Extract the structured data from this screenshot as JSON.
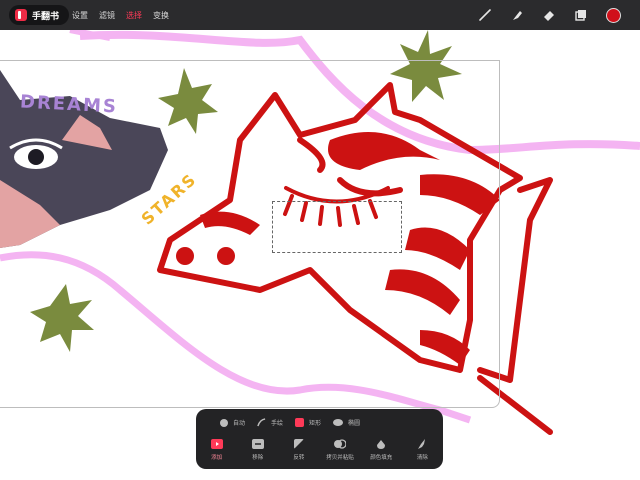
{
  "app": {
    "title": "手翻书"
  },
  "menu": {
    "items": [
      {
        "label": "设置",
        "active": false
      },
      {
        "label": "滤镜",
        "active": false
      },
      {
        "label": "选择",
        "active": true
      },
      {
        "label": "变换",
        "active": false
      }
    ]
  },
  "toolbar": {
    "icons": [
      "brush-icon",
      "smudge-icon",
      "eraser-icon",
      "layers-icon",
      "color-picker-icon"
    ],
    "current_color": "#d0101a"
  },
  "canvas": {
    "texts": {
      "dreams": "DREAMS",
      "stars": "STARS"
    },
    "colors": {
      "red": "#cc1212",
      "pink": "#f4b4f2",
      "green": "#7a8b3e",
      "dark": "#4a4658"
    }
  },
  "selection_panel": {
    "modes": [
      {
        "label": "自动",
        "icon": "dot-icon"
      },
      {
        "label": "手绘",
        "icon": "pen-icon"
      },
      {
        "label": "矩形",
        "icon": "rectangle-icon",
        "active": true
      },
      {
        "label": "椭圆",
        "icon": "ellipse-icon"
      }
    ],
    "actions": [
      {
        "label": "添加",
        "icon": "add-icon",
        "active": true
      },
      {
        "label": "移除",
        "icon": "remove-icon"
      },
      {
        "label": "反转",
        "icon": "invert-icon"
      },
      {
        "label": "拷贝并粘贴",
        "icon": "copy-paste-icon"
      },
      {
        "label": "颜色填充",
        "icon": "fill-icon"
      },
      {
        "label": "清除",
        "icon": "clear-icon"
      }
    ]
  }
}
